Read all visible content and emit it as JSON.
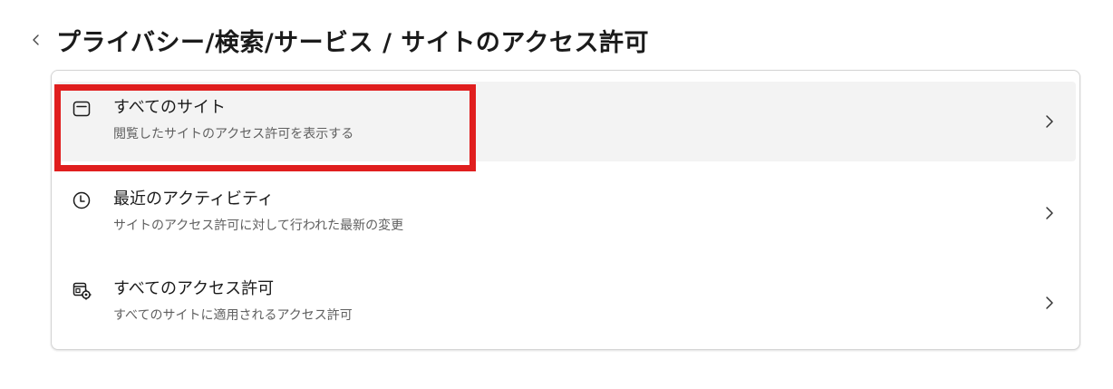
{
  "header": {
    "title": "プライバシー/検索/サービス / サイトのアクセス許可",
    "back_icon": "chevron-left-icon"
  },
  "rows": [
    {
      "label": "すべてのサイト",
      "description": "閲覧したサイトのアクセス許可を表示する",
      "icon": "browser-window-icon"
    },
    {
      "label": "最近のアクティビティ",
      "description": "サイトのアクセス許可に対して行われた最新の変更",
      "icon": "clock-icon"
    },
    {
      "label": "すべてのアクセス許可",
      "description": "すべてのサイトに適用されるアクセス許可",
      "icon": "permissions-settings-icon"
    }
  ],
  "highlight_color": "#e01e1e"
}
